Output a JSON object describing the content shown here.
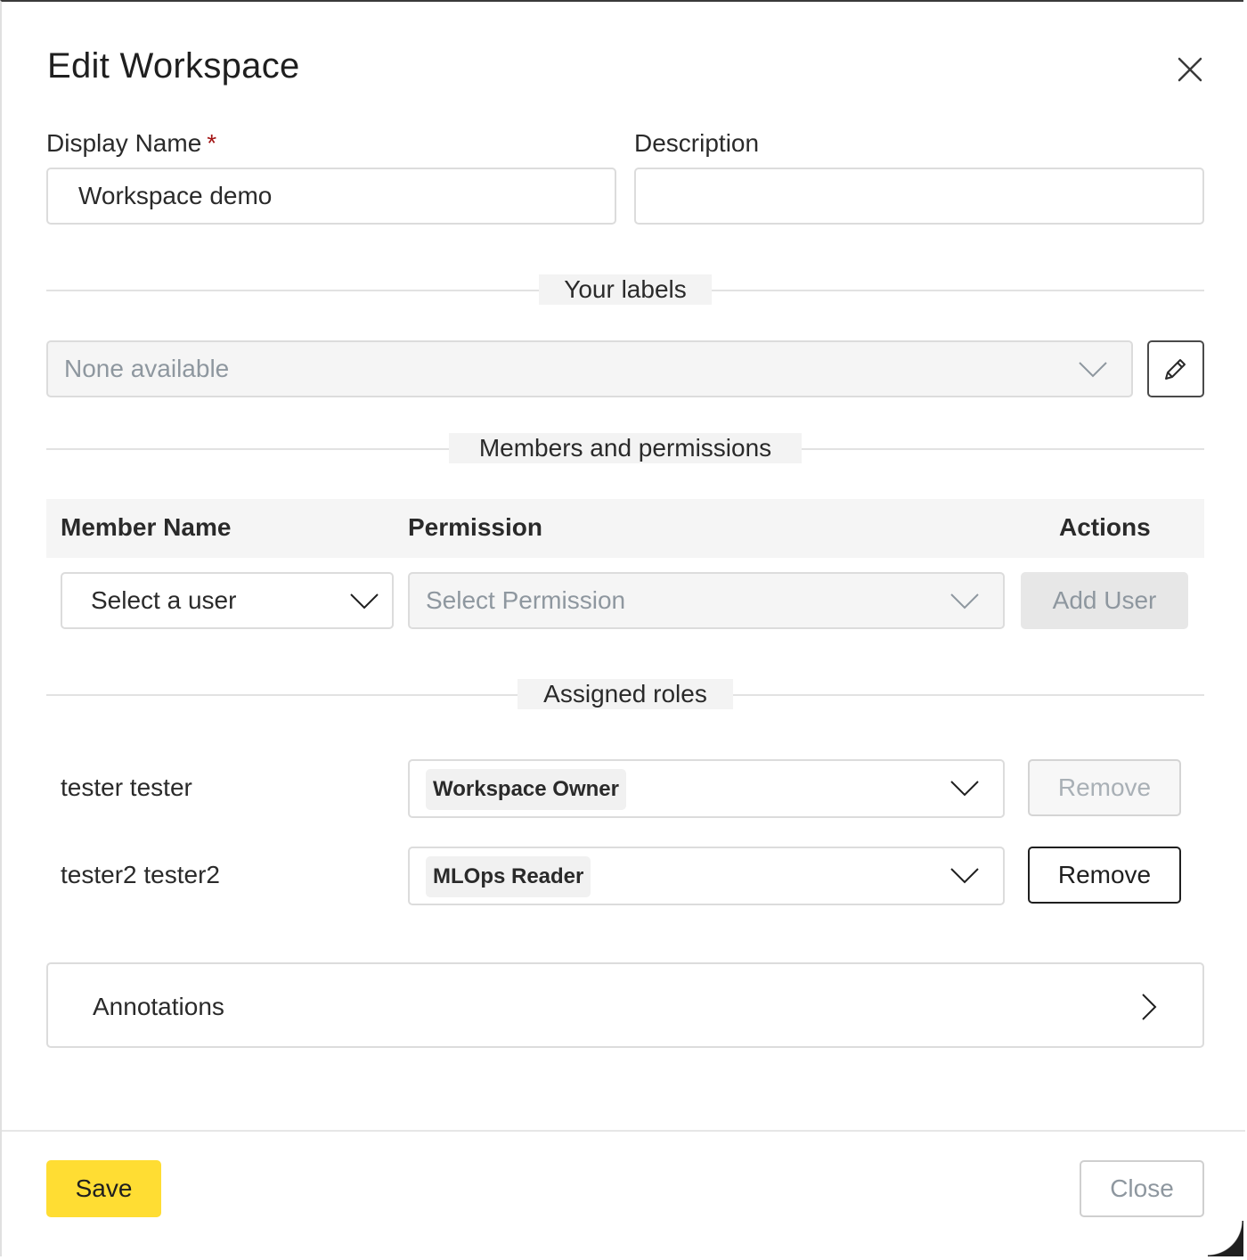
{
  "dialog": {
    "title": "Edit Workspace"
  },
  "form": {
    "display_name_label": "Display Name",
    "required_marker": "*",
    "display_name_value": "Workspace demo",
    "description_label": "Description",
    "description_value": ""
  },
  "labels_section": {
    "heading": "Your labels",
    "select_placeholder": "None available"
  },
  "members_section": {
    "heading": "Members and permissions",
    "columns": [
      "Member Name",
      "Permission",
      "Actions"
    ],
    "user_select_placeholder": "Select a user",
    "permission_select_placeholder": "Select Permission",
    "add_user_label": "Add User"
  },
  "roles_section": {
    "heading": "Assigned roles",
    "rows": [
      {
        "member": "tester tester",
        "role": "Workspace Owner",
        "remove_label": "Remove",
        "remove_enabled": false
      },
      {
        "member": "tester2 tester2",
        "role": "MLOps Reader",
        "remove_label": "Remove",
        "remove_enabled": true
      }
    ]
  },
  "annotations": {
    "label": "Annotations"
  },
  "footer": {
    "save_label": "Save",
    "close_label": "Close"
  },
  "icons": {
    "close": "close-icon",
    "chevron_down": "chevron-down-icon",
    "chevron_right": "chevron-right-icon",
    "edit": "pencil-icon"
  },
  "colors": {
    "primary_button": "#ffdd33",
    "required": "#a31515",
    "disabled_text": "#8e979f"
  }
}
